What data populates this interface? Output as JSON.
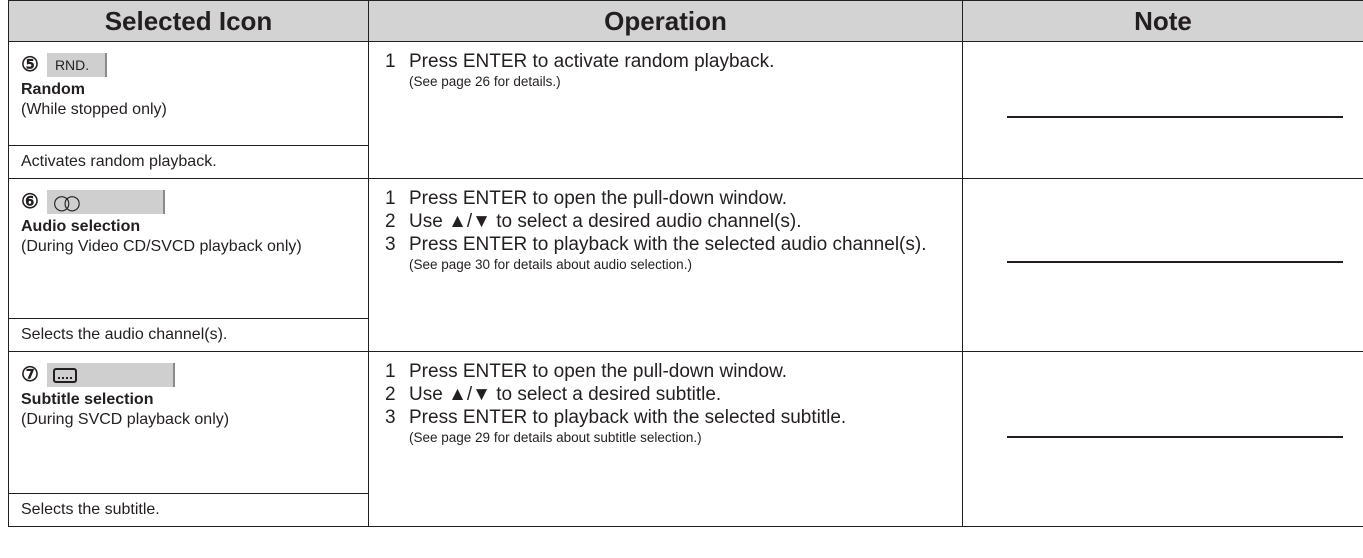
{
  "headers": {
    "icon": "Selected Icon",
    "operation": "Operation",
    "note": "Note"
  },
  "rows": [
    {
      "number": "⑤",
      "button_label": "RND.",
      "name": "Random",
      "condition": "(While stopped only)",
      "description": "Activates random playback.",
      "steps": [
        {
          "n": "1",
          "text": "Press ENTER to activate random playback."
        }
      ],
      "reference": "(See page 26 for details.)"
    },
    {
      "number": "⑥",
      "button_icon": "audio-channel-icon",
      "name": "Audio selection",
      "condition": "(During Video CD/SVCD playback only)",
      "description": "Selects the audio channel(s).",
      "steps": [
        {
          "n": "1",
          "text": "Press ENTER to open the pull-down window."
        },
        {
          "n": "2",
          "text": "Use ▲/▼ to select a desired audio channel(s)."
        },
        {
          "n": "3",
          "text": "Press ENTER to playback with the selected audio channel(s)."
        }
      ],
      "reference": "(See page 30 for details about audio selection.)"
    },
    {
      "number": "⑦",
      "button_icon": "subtitle-icon",
      "name": "Subtitle selection",
      "condition": "(During SVCD playback only)",
      "description": "Selects the subtitle.",
      "steps": [
        {
          "n": "1",
          "text": "Press ENTER to open the pull-down window."
        },
        {
          "n": "2",
          "text": "Use ▲/▼ to select a desired subtitle."
        },
        {
          "n": "3",
          "text": "Press ENTER to playback with the selected subtitle."
        }
      ],
      "reference": "(See page 29 for details about subtitle selection.)"
    }
  ]
}
